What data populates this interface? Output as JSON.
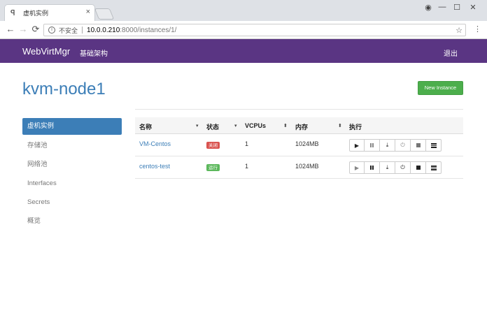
{
  "browser": {
    "tab_title": "虚机实例",
    "tab_close": "×",
    "favicon": "ꟼ",
    "insecure_label": "不安全",
    "url_host": "10.0.0.210",
    "url_path": ":8000/instances/1/",
    "back": "←",
    "forward": "→",
    "reload": "⟳",
    "star": "☆",
    "menu": "⋮",
    "account_icon": "◉",
    "minimize": "—",
    "maximize": "☐",
    "close": "✕"
  },
  "navbar": {
    "brand": "WebVirtMgr",
    "infrastructure": "基础架构",
    "logout": "退出",
    "color": "#5a3583"
  },
  "page": {
    "title": "kvm-node1",
    "new_instance": "New Instance"
  },
  "sidebar": {
    "items": [
      {
        "label": "虚机实例",
        "active": true
      },
      {
        "label": "存储池"
      },
      {
        "label": "网络池"
      },
      {
        "label": "Interfaces"
      },
      {
        "label": "Secrets"
      },
      {
        "label": "概览"
      }
    ]
  },
  "table": {
    "columns": [
      "名称",
      "状态",
      "VCPUs",
      "内存",
      "执行"
    ],
    "sort_down": "▾",
    "sort_both": "⬍",
    "rows": [
      {
        "name": "VM-Centos",
        "status": "关闭",
        "status_color": "#d9534f",
        "vcpus": "1",
        "memory": "1024MB"
      },
      {
        "name": "centos-test",
        "status": "运行",
        "status_color": "#5cb85c",
        "vcpus": "1",
        "memory": "1024MB"
      }
    ],
    "action_icons": [
      "play-icon",
      "pause-icon",
      "download-icon",
      "power-icon",
      "stop-icon",
      "menu-icon"
    ],
    "glyphs": {
      "play": "▶",
      "download": "⤓",
      "power": "⏻"
    }
  }
}
